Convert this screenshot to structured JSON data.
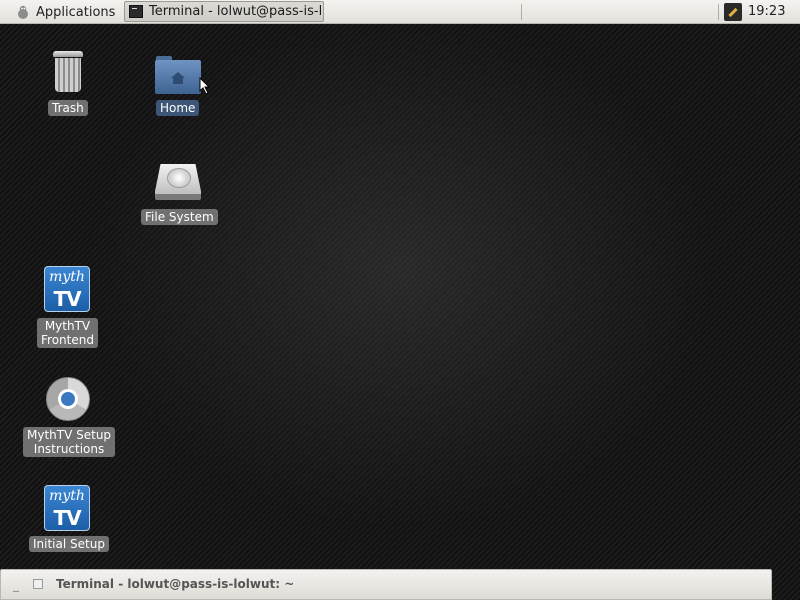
{
  "top_panel": {
    "applications_label": "Applications",
    "task_title": "Terminal - lolwut@pass-is-l...",
    "clock": "19:23"
  },
  "desktop_icons": [
    {
      "label": "Trash",
      "icon": "trash-icon"
    },
    {
      "label": "Home",
      "icon": "home-folder-icon",
      "selected": true
    },
    {
      "label": "File System",
      "icon": "filesystem-icon"
    },
    {
      "label": "MythTV\nFrontend",
      "icon": "mythtv-icon"
    },
    {
      "label": "MythTV Setup\nInstructions",
      "icon": "chrome-icon"
    },
    {
      "label": "Initial Setup",
      "icon": "mythtv-icon"
    }
  ],
  "myth_logo": {
    "top": "myth",
    "bottom": "TV"
  },
  "bottom_window": {
    "title": "Terminal - lolwut@pass-is-lolwut: ~"
  },
  "colors": {
    "panel_bg": "#e8e6e1",
    "label_bg": "#808080",
    "label_selected_bg": "#3d5677",
    "myth_blue": "#2a72c0"
  }
}
